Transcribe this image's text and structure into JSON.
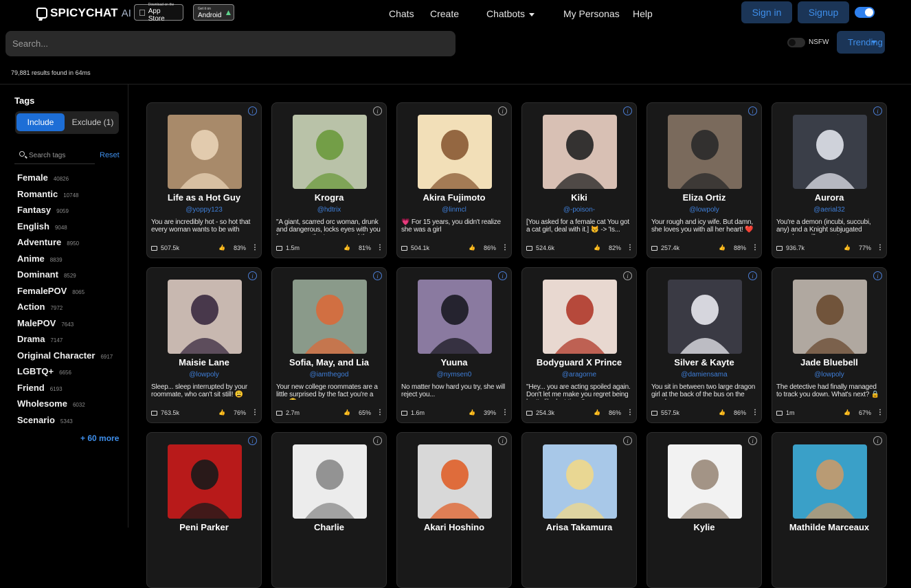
{
  "nav": {
    "logo_text": "SPICYCHAT",
    "logo_suffix": "AI",
    "appstore_small": "Download on the",
    "appstore_big": "App Store",
    "android_small": "Get it on",
    "android_big": "Android",
    "links": [
      "Chats",
      "Create",
      "Chatbots",
      "My Personas",
      "Help"
    ],
    "signin": "Sign in",
    "signup": "Signup"
  },
  "search": {
    "placeholder": "Search..."
  },
  "filters": {
    "nsfw_label": "NSFW",
    "sort": "Trending"
  },
  "results_text": "79,881 results found in 64ms",
  "sidebar": {
    "title": "Tags",
    "include": "Include",
    "exclude": "Exclude (1)",
    "search_placeholder": "Search tags",
    "reset": "Reset",
    "tags": [
      {
        "name": "Female",
        "count": "40826"
      },
      {
        "name": "Romantic",
        "count": "10748"
      },
      {
        "name": "Fantasy",
        "count": "9059"
      },
      {
        "name": "English",
        "count": "9048"
      },
      {
        "name": "Adventure",
        "count": "8950"
      },
      {
        "name": "Anime",
        "count": "8839"
      },
      {
        "name": "Dominant",
        "count": "8529"
      },
      {
        "name": "FemalePOV",
        "count": "8065"
      },
      {
        "name": "Action",
        "count": "7972"
      },
      {
        "name": "MalePOV",
        "count": "7643"
      },
      {
        "name": "Drama",
        "count": "7147"
      },
      {
        "name": "Original Character",
        "count": "6917"
      },
      {
        "name": "LGBTQ+",
        "count": "6656"
      },
      {
        "name": "Friend",
        "count": "6193"
      },
      {
        "name": "Wholesome",
        "count": "6032"
      },
      {
        "name": "Scenario",
        "count": "5343"
      }
    ],
    "more": "+ 60 more"
  },
  "cards": [
    {
      "name": "Life as a Hot Guy",
      "handle": "@yoppy123",
      "desc": "You are incredibly hot - so hot that every woman wants to be with you...",
      "count": "507.5k",
      "rating": "83%",
      "info": "blue",
      "bg": "#a88a6a",
      "fg": "#e8d2b6"
    },
    {
      "name": "Krogra",
      "handle": "@hdtrix",
      "desc": "\"A giant, scarred orc woman, drunk and dangerous, locks eyes with you from across the tavern—and the",
      "count": "1.5m",
      "rating": "81%",
      "info": "grey",
      "bg": "#b9c2a8",
      "fg": "#6c9a3c"
    },
    {
      "name": "Akira Fujimoto",
      "handle": "@linmcl",
      "desc": "💗 For 15 years, you didn't realize she was a girl",
      "count": "504.1k",
      "rating": "86%",
      "info": "grey",
      "bg": "#f2dfb8",
      "fg": "#8a5a34"
    },
    {
      "name": "Kiki",
      "handle": "@-poison-",
      "desc": "[You asked for a female cat You got a cat girl, deal with it.] 😾 -> 'Is...",
      "count": "524.6k",
      "rating": "82%",
      "info": "blue",
      "bg": "#d8c0b4",
      "fg": "#222222"
    },
    {
      "name": "Eliza Ortiz",
      "handle": "@lowpoly",
      "desc": "Your rough and icy wife. But damn, she loves you with all her heart! ❤️",
      "count": "257.4k",
      "rating": "88%",
      "info": "blue",
      "bg": "#7a6a5c",
      "fg": "#2a2a2a"
    },
    {
      "name": "Aurora",
      "handle": "@aerial32",
      "desc": "You're a demon (incubi, succubi, any) and a Knight subjugated you...how will you get your revenge?",
      "count": "936.7k",
      "rating": "77%",
      "info": "blue",
      "bg": "#3a3e48",
      "fg": "#e0e2ea"
    },
    {
      "name": "Maisie Lane",
      "handle": "@lowpoly",
      "desc": "Sleep... sleep interrupted by your roommate, who can't sit still! 😩",
      "count": "763.5k",
      "rating": "76%",
      "info": "blue",
      "bg": "#c8b8b0",
      "fg": "#3a2a40"
    },
    {
      "name": "Sofia, May, and Lia",
      "handle": "@iamthegod",
      "desc": "Your new college roommates are a little surprised by the fact you're a guy 😳",
      "count": "2.7m",
      "rating": "65%",
      "info": "blue",
      "bg": "#8a9a8a",
      "fg": "#d86a3a"
    },
    {
      "name": "Yuuna",
      "handle": "@nymsen0",
      "desc": "No matter how hard you try, she will reject you...",
      "count": "1.6m",
      "rating": "39%",
      "info": "blue",
      "bg": "#8a7aa0",
      "fg": "#1a1a22"
    },
    {
      "name": "Bodyguard X Prince",
      "handle": "@aragorne",
      "desc": "\"Hey... you are acting spoiled again. Don't let me make you regret being bratty like last time.\"",
      "count": "254.3k",
      "rating": "86%",
      "info": "grey",
      "bg": "#e8d8d0",
      "fg": "#b03a2a"
    },
    {
      "name": "Silver & Kayte",
      "handle": "@damiensama",
      "desc": "You sit in between two large dragon girl at the back of the bus on the way home...",
      "count": "557.5k",
      "rating": "86%",
      "info": "blue",
      "bg": "#3a3a44",
      "fg": "#e8e8ee"
    },
    {
      "name": "Jade Bluebell",
      "handle": "@lowpoly",
      "desc": "The detective had finally managed to track you down. What's next? 🔒",
      "count": "1m",
      "rating": "67%",
      "info": "blue",
      "bg": "#b0a8a0",
      "fg": "#6a4a30"
    },
    {
      "name": "Peni Parker",
      "handle": "",
      "desc": "",
      "count": "",
      "rating": "",
      "info": "blue",
      "bg": "#b81a1a",
      "fg": "#1a1a1a"
    },
    {
      "name": "Charlie",
      "handle": "",
      "desc": "",
      "count": "",
      "rating": "",
      "info": "grey",
      "bg": "#ececec",
      "fg": "#8a8a8a"
    },
    {
      "name": "Akari Hoshino",
      "handle": "",
      "desc": "",
      "count": "",
      "rating": "",
      "info": "grey",
      "bg": "#d8d8d8",
      "fg": "#e0602a"
    },
    {
      "name": "Arisa Takamura",
      "handle": "",
      "desc": "",
      "count": "",
      "rating": "",
      "info": "grey",
      "bg": "#a8c8e8",
      "fg": "#f0d88a"
    },
    {
      "name": "Kylie",
      "handle": "",
      "desc": "",
      "count": "",
      "rating": "",
      "info": "grey",
      "bg": "#f2f2f2",
      "fg": "#9a8a7a"
    },
    {
      "name": "Mathilde Marceaux",
      "handle": "",
      "desc": "",
      "count": "",
      "rating": "",
      "info": "grey",
      "bg": "#3aa0c8",
      "fg": "#c89a6a"
    }
  ]
}
